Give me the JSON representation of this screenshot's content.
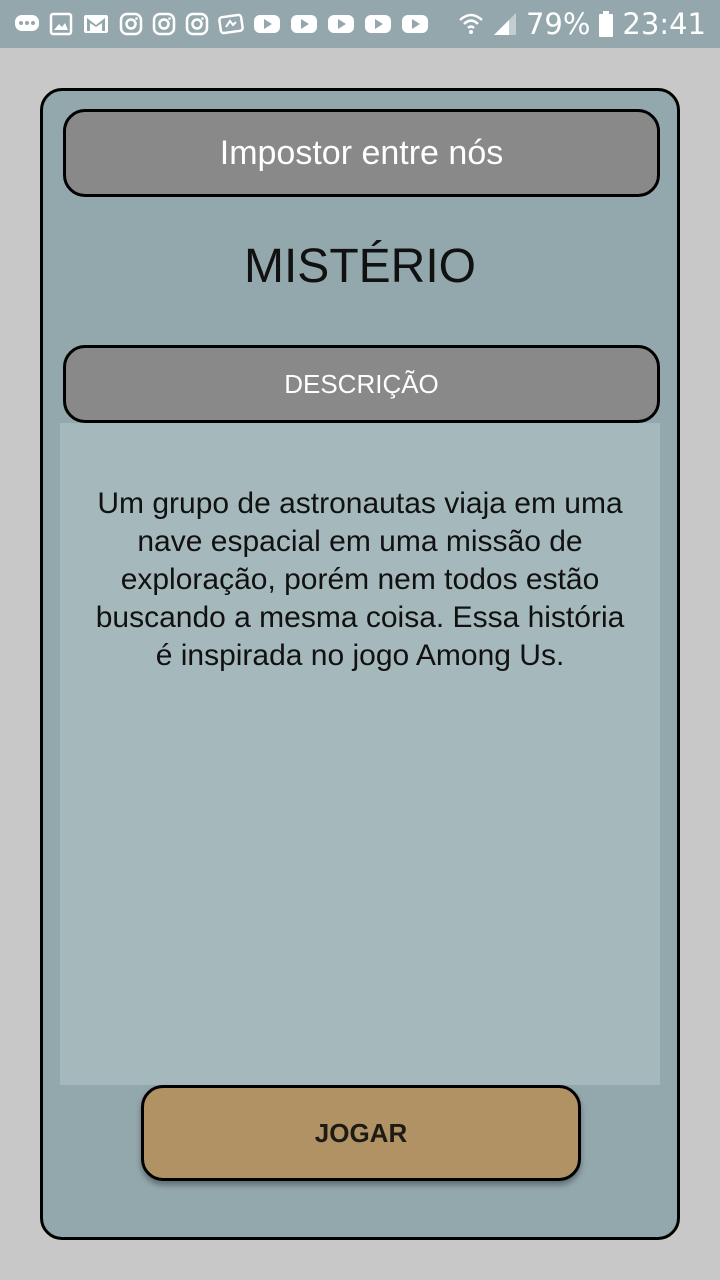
{
  "status_bar": {
    "notification_icons": [
      "chat-icon",
      "gallery-icon",
      "gmail-icon",
      "instagram-icon",
      "instagram-icon",
      "instagram-icon",
      "app-icon",
      "youtube-icon",
      "youtube-icon",
      "youtube-icon",
      "youtube-icon",
      "youtube-icon"
    ],
    "battery_percent": "79%",
    "time": "23:41"
  },
  "story": {
    "title": "Impostor entre nós",
    "genre": "MISTÉRIO",
    "description_header": "DESCRIÇÃO",
    "description": "Um grupo de astronautas viaja em uma nave espacial em uma missão de exploração, porém nem todos estão buscando a mesma coisa. Essa história é inspirada no jogo Among Us."
  },
  "actions": {
    "play_label": "JOGAR"
  },
  "colors": {
    "background": "#c8c8c8",
    "card": "#93a8ad",
    "title_bar": "#898989",
    "description_box": "#a5b9bd",
    "play_button": "#b09265"
  }
}
